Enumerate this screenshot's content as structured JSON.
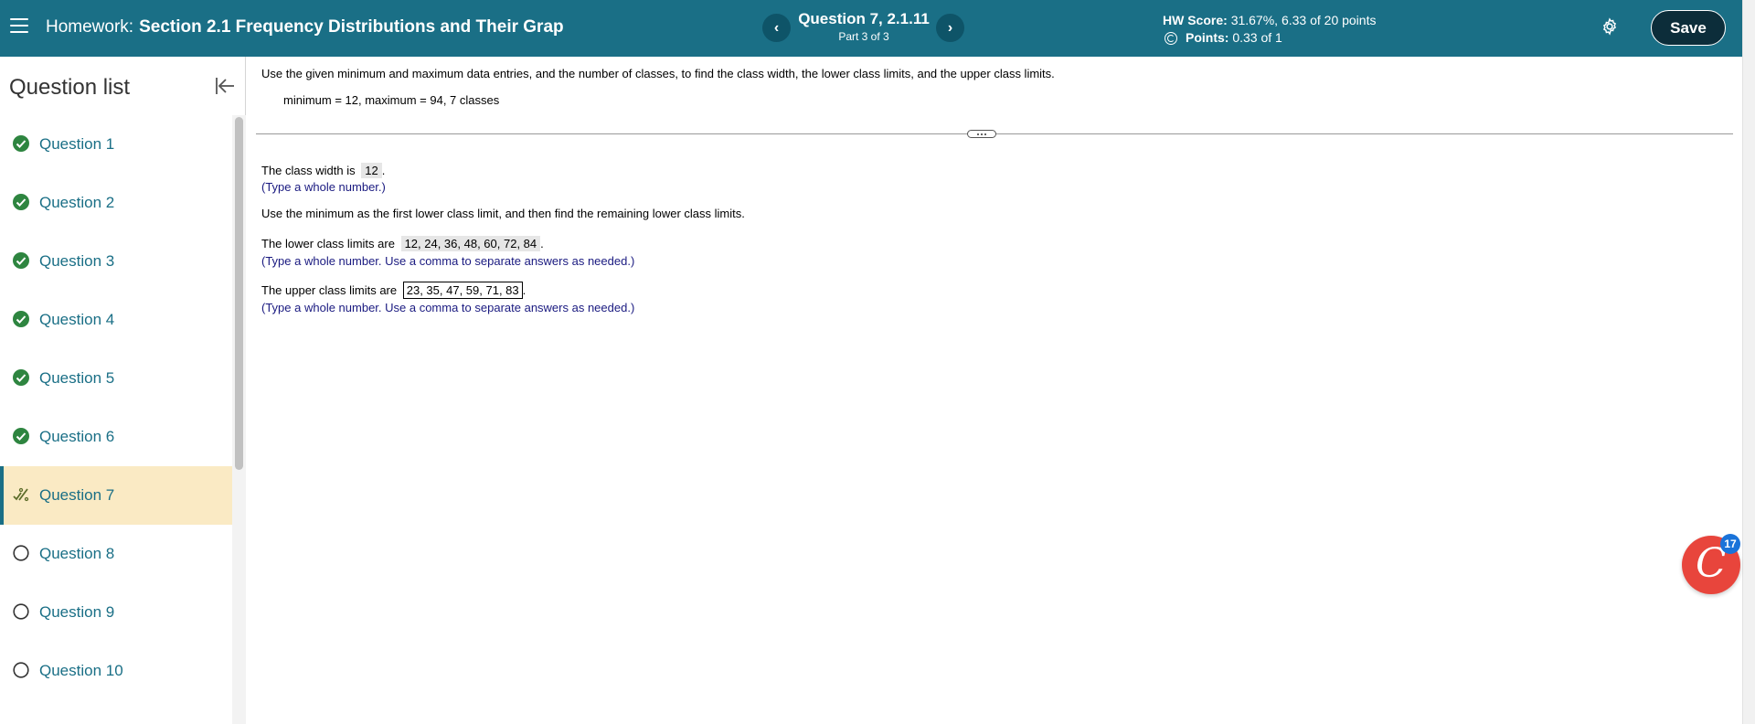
{
  "header": {
    "title_label": "Homework:",
    "title_name": "Section 2.1 Frequency Distributions and Their Grap",
    "question_title": "Question 7, 2.1.11",
    "question_part": "Part 3 of 3",
    "prev_label": "‹",
    "next_label": "›",
    "hw_score_label": "HW Score:",
    "hw_score_value": "31.67%, 6.33 of 20 points",
    "points_label": "Points:",
    "points_value": "0.33 of 1",
    "save_label": "Save"
  },
  "sidebar": {
    "title": "Question list",
    "items": [
      {
        "label": "Question 1",
        "status": "complete"
      },
      {
        "label": "Question 2",
        "status": "complete"
      },
      {
        "label": "Question 3",
        "status": "complete"
      },
      {
        "label": "Question 4",
        "status": "complete"
      },
      {
        "label": "Question 5",
        "status": "complete"
      },
      {
        "label": "Question 6",
        "status": "complete"
      },
      {
        "label": "Question 7",
        "status": "partial"
      },
      {
        "label": "Question 8",
        "status": "unanswered"
      },
      {
        "label": "Question 9",
        "status": "unanswered"
      },
      {
        "label": "Question 10",
        "status": "unanswered"
      }
    ]
  },
  "content": {
    "prompt": "Use the given minimum and maximum data entries, and the number of classes, to find the class width, the lower class limits, and the upper class limits.",
    "given": "minimum = 12,  maximum = 94, 7 classes",
    "class_width_prefix": "The class width is",
    "class_width_value": "12",
    "class_width_hint": "(Type a whole number.)",
    "instruction": "Use the minimum as the first lower class limit, and then find the remaining lower class limits.",
    "lower_prefix": "The lower class limits are",
    "lower_value": "12, 24, 36, 48, 60, 72, 84",
    "lower_hint": "(Type a whole number. Use a comma to separate answers as needed.)",
    "upper_prefix": "The upper class limits are",
    "upper_value": "23, 35, 47, 59, 71, 83",
    "upper_hint": "(Type a whole number. Use a comma to separate answers as needed.)",
    "period": "."
  },
  "chat": {
    "glyph": "C",
    "badge": "17"
  },
  "colors": {
    "header_bg": "#1a6f86",
    "link": "#1a6f86",
    "complete": "#2e8540",
    "partial": "#5d6d2a",
    "active_bg": "#faeac4",
    "chat_bg": "#e8453c",
    "badge_bg": "#1a73d9"
  }
}
